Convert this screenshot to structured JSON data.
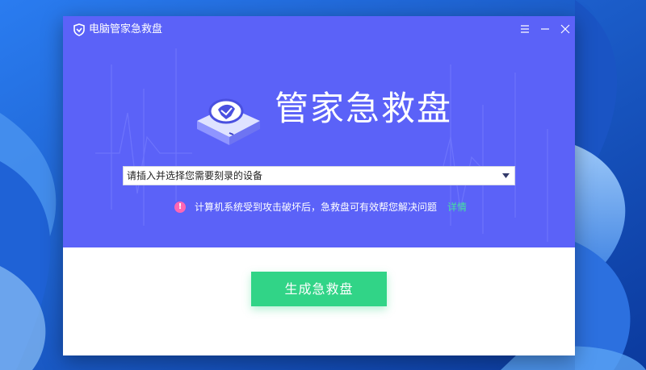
{
  "window": {
    "title": "电脑管家急救盘",
    "controls": {
      "menu_icon": "menu-icon",
      "minimize_icon": "minimize-icon",
      "close_icon": "close-icon"
    }
  },
  "hero": {
    "product_title": "管家急救盘",
    "device_select": {
      "selected": "请插入并选择您需要刻录的设备"
    },
    "notice": {
      "text": "计算机系统受到攻击破坏后，急救盘可有效帮您解决问题",
      "link": "详情",
      "icon": "!"
    }
  },
  "actions": {
    "make_label": "生成急救盘"
  },
  "colors": {
    "hero_bg": "#5b62f8",
    "primary_button": "#31d487",
    "link": "#45e0a0",
    "alert_icon": "#ff66b3"
  }
}
